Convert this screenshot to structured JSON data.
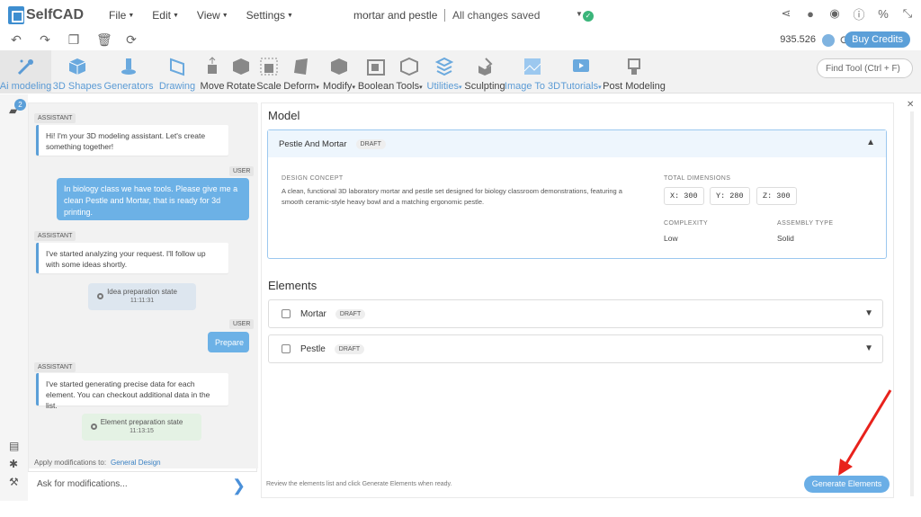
{
  "app": {
    "name": "SelfCAD"
  },
  "menus": [
    "File",
    "Edit",
    "View",
    "Settings"
  ],
  "document": {
    "title": "mortar and pestle",
    "save_status": "All changes saved"
  },
  "credits": {
    "amount": "935.526",
    "buy_label": "Buy Credits"
  },
  "tools": [
    {
      "label": "Ai modeling",
      "icon": "ai-modeling-icon"
    },
    {
      "label": "3D Shapes",
      "icon": "cube-icon"
    },
    {
      "label": "Generators",
      "icon": "generator-icon"
    },
    {
      "label": "Drawing",
      "icon": "drawing-icon"
    },
    {
      "label": "Move",
      "icon": "move-icon"
    },
    {
      "label": "Rotate",
      "icon": "rotate-icon"
    },
    {
      "label": "Scale",
      "icon": "scale-icon"
    },
    {
      "label": "Deform",
      "icon": "deform-icon"
    },
    {
      "label": "Modify",
      "icon": "modify-icon"
    },
    {
      "label": "Boolean",
      "icon": "boolean-icon"
    },
    {
      "label": "Tools",
      "icon": "tools-icon"
    },
    {
      "label": "Utilities",
      "icon": "utilities-icon"
    },
    {
      "label": "Sculpting",
      "icon": "sculpting-icon"
    },
    {
      "label": "Image To 3D",
      "icon": "image-to-3d-icon"
    },
    {
      "label": "Tutorials",
      "icon": "tutorials-icon"
    },
    {
      "label": "Post Modeling",
      "icon": "post-modeling-icon"
    }
  ],
  "find_tool": {
    "placeholder": "Find Tool (Ctrl + F)"
  },
  "chat": {
    "badge_count": "2",
    "messages": [
      {
        "role": "ASSISTANT",
        "text": "Hi! I'm your 3D modeling assistant. Let's create something together!"
      },
      {
        "role": "USER",
        "text": "In biology class we have tools. Please give me a clean Pestle and Mortar, that is ready for 3d printing."
      },
      {
        "role": "ASSISTANT",
        "text": "I've started analyzing your request. I'll follow up with some ideas shortly."
      },
      {
        "role": "STATE",
        "text": "Idea preparation state",
        "time": "11:11:31"
      },
      {
        "role": "USER",
        "text": "Prepare"
      },
      {
        "role": "ASSISTANT",
        "text": "I've started generating precise data for each element. You can checkout additional data in the list."
      },
      {
        "role": "STATE",
        "text": "Element preparation state",
        "time": "11:13:15"
      }
    ],
    "apply_label": "Apply modifications to:",
    "apply_target": "General Design",
    "input_placeholder": "Ask for modifications..."
  },
  "model": {
    "heading": "Model",
    "name": "Pestle And Mortar",
    "status": "DRAFT",
    "design_concept_label": "DESIGN CONCEPT",
    "design_concept": "A clean, functional 3D laboratory mortar and pestle set designed for biology classroom demonstrations, featuring a smooth ceramic-style heavy bowl and a matching ergonomic pestle.",
    "dimensions_label": "TOTAL DIMENSIONS",
    "dim_x": "X: 300",
    "dim_y": "Y: 280",
    "dim_z": "Z: 300",
    "complexity_label": "COMPLEXITY",
    "complexity": "Low",
    "assembly_label": "ASSEMBLY TYPE",
    "assembly": "Solid"
  },
  "elements": {
    "heading": "Elements",
    "items": [
      {
        "name": "Mortar",
        "status": "DRAFT"
      },
      {
        "name": "Pestle",
        "status": "DRAFT"
      }
    ]
  },
  "footer": {
    "hint": "Review the elements list and click Generate Elements when ready.",
    "generate_label": "Generate Elements"
  },
  "colors": {
    "accent": "#5b9fd8",
    "annotation_arrow": "#e8221c"
  }
}
